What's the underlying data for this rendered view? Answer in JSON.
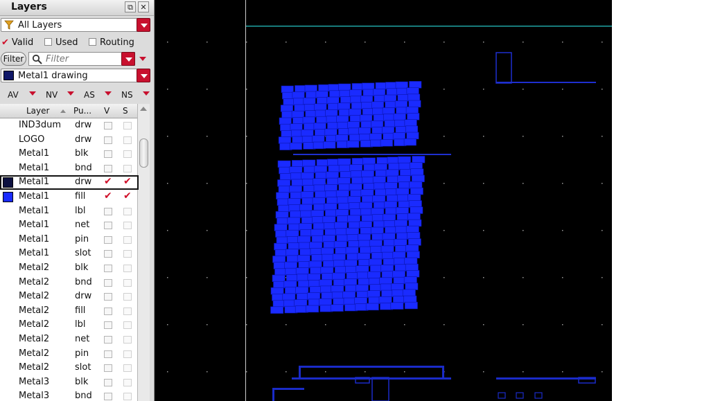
{
  "panel": {
    "title": "Layers",
    "layer_filter": "All Layers",
    "checks": [
      {
        "label": "Valid",
        "checked": true
      },
      {
        "label": "Used",
        "checked": false
      },
      {
        "label": "Routing",
        "checked": false
      }
    ],
    "filter_button": "Filter",
    "filter_placeholder": "Filter",
    "current_layer": "Metal1 drawing",
    "visibility_selectors": [
      "AV",
      "NV",
      "AS",
      "NS"
    ],
    "columns": {
      "layer": "Layer",
      "purpose": "Pu...",
      "visible": "V",
      "selectable": "S"
    },
    "rows": [
      {
        "layer": "IND3dum",
        "purpose": "drw",
        "v": false,
        "s": false
      },
      {
        "layer": "LOGO",
        "purpose": "drw",
        "v": false,
        "s": false
      },
      {
        "layer": "Metal1",
        "purpose": "blk",
        "v": false,
        "s": false
      },
      {
        "layer": "Metal1",
        "purpose": "bnd",
        "v": false,
        "s": false
      },
      {
        "layer": "Metal1",
        "purpose": "drw",
        "v": true,
        "s": true,
        "swatch": "dark",
        "selected": true
      },
      {
        "layer": "Metal1",
        "purpose": "fill",
        "v": true,
        "s": true,
        "swatch": "blue"
      },
      {
        "layer": "Metal1",
        "purpose": "lbl",
        "v": false,
        "s": false
      },
      {
        "layer": "Metal1",
        "purpose": "net",
        "v": false,
        "s": false
      },
      {
        "layer": "Metal1",
        "purpose": "pin",
        "v": false,
        "s": false
      },
      {
        "layer": "Metal1",
        "purpose": "slot",
        "v": false,
        "s": false
      },
      {
        "layer": "Metal2",
        "purpose": "blk",
        "v": false,
        "s": false
      },
      {
        "layer": "Metal2",
        "purpose": "bnd",
        "v": false,
        "s": false
      },
      {
        "layer": "Metal2",
        "purpose": "drw",
        "v": false,
        "s": false
      },
      {
        "layer": "Metal2",
        "purpose": "fill",
        "v": false,
        "s": false
      },
      {
        "layer": "Metal2",
        "purpose": "lbl",
        "v": false,
        "s": false
      },
      {
        "layer": "Metal2",
        "purpose": "net",
        "v": false,
        "s": false
      },
      {
        "layer": "Metal2",
        "purpose": "pin",
        "v": false,
        "s": false
      },
      {
        "layer": "Metal2",
        "purpose": "slot",
        "v": false,
        "s": false
      },
      {
        "layer": "Metal3",
        "purpose": "blk",
        "v": false,
        "s": false
      },
      {
        "layer": "Metal3",
        "purpose": "bnd",
        "v": false,
        "s": false
      }
    ]
  },
  "colors": {
    "accent_red": "#c8102e",
    "metal_fill": "#1a2bff",
    "canvas_bg": "#000000",
    "guide_cyan": "#1fa5a5"
  },
  "icons": {
    "filter": "funnel-icon",
    "search": "magnifier-icon",
    "float": "float-window-icon",
    "close": "close-icon"
  }
}
